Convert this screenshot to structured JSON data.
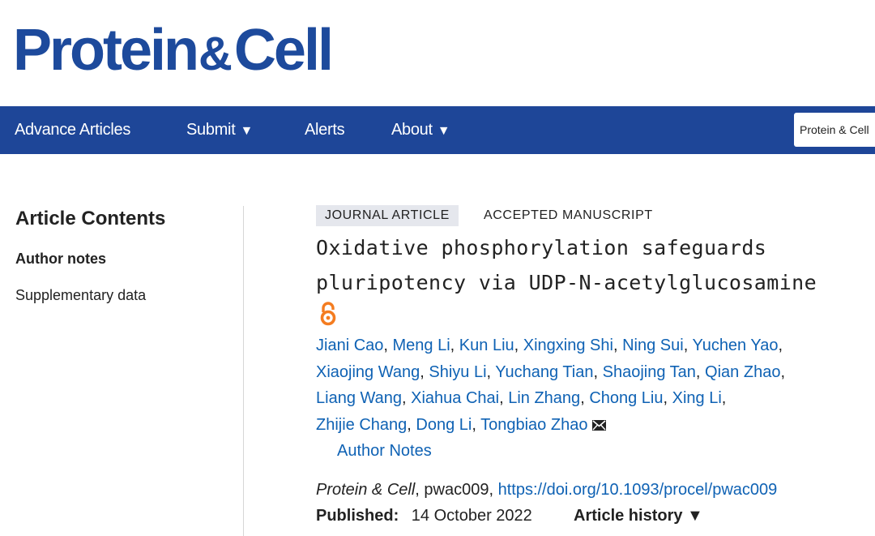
{
  "brand": {
    "part1": "Protein",
    "amp": "&",
    "part2": "Cell",
    "color": "#1d4a9c"
  },
  "nav": {
    "bg_color": "#1e4698",
    "items": [
      {
        "label": "Advance Articles",
        "caret": ""
      },
      {
        "label": "Submit",
        "caret": "▼"
      },
      {
        "label": "Alerts",
        "caret": ""
      },
      {
        "label": "About",
        "caret": "▼"
      }
    ],
    "search_scope": "Protein & Cell"
  },
  "sidebar": {
    "title": "Article Contents",
    "items": [
      {
        "label": "Author notes"
      },
      {
        "label": "Supplementary data"
      }
    ]
  },
  "article": {
    "type_tag": "JOURNAL ARTICLE",
    "status_tag": "ACCEPTED MANUSCRIPT",
    "title": "Oxidative phosphorylation safeguards pluripotency via UDP-N-acetylglucosamine",
    "open_access_icon": "open-access-icon",
    "authors": [
      "Jiani Cao",
      "Meng Li",
      "Kun Liu",
      "Xingxing Shi",
      "Ning Sui",
      "Yuchen Yao",
      "Xiaojing Wang",
      "Shiyu Li",
      "Yuchang Tian",
      "Shaojing Tan",
      "Qian Zhao",
      "Liang Wang",
      "Xiahua Chai",
      "Lin Zhang",
      "Chong Liu",
      "Xing Li",
      "Zhijie Chang",
      "Dong Li",
      "Tongbiao Zhao"
    ],
    "author_notes_label": "Author Notes",
    "citation": {
      "journal": "Protein & Cell",
      "id": ", pwac009, ",
      "doi": "https://doi.org/10.1093/procel/pwac009"
    },
    "published_label": "Published:",
    "published_date": "14 October 2022",
    "history_label": "Article history ▼"
  },
  "colors": {
    "link": "#0f62b4",
    "open_access": "#f47c20",
    "tag_bg": "#e5e7ed"
  }
}
